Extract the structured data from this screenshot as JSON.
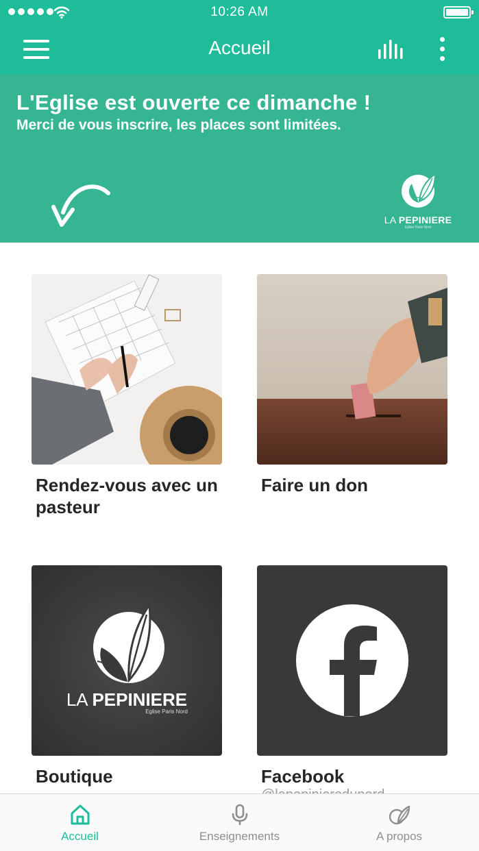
{
  "status_bar": {
    "time": "10:26 AM"
  },
  "nav": {
    "title": "Accueil"
  },
  "banner": {
    "headline": "L'Eglise est ouverte ce dimanche !",
    "subline": "Merci de vous inscrire, les places sont limitées.",
    "logo_name_light": "LA ",
    "logo_name_bold": "PEPINIERE",
    "logo_sub": "Eglise Paris Nord"
  },
  "tiles": [
    {
      "label": "Rendez-vous avec un pasteur"
    },
    {
      "label": "Faire un don"
    },
    {
      "label": "Boutique",
      "logo_name_light": "LA ",
      "logo_name_bold": "PEPINIERE",
      "logo_sub": "Eglise Paris Nord"
    },
    {
      "label": "Facebook",
      "sublabel": "@lapepinieredunord"
    }
  ],
  "tabs": [
    {
      "label": "Accueil",
      "icon": "home-icon",
      "active": true
    },
    {
      "label": "Enseignements",
      "icon": "microphone-icon",
      "active": false
    },
    {
      "label": "A propos",
      "icon": "leaf-icon",
      "active": false
    }
  ],
  "colors": {
    "accent": "#1fbc9a",
    "banner": "#36b593",
    "tile_dark": "#393939",
    "text": "#262626",
    "tab_inactive": "#8e8e8e"
  }
}
